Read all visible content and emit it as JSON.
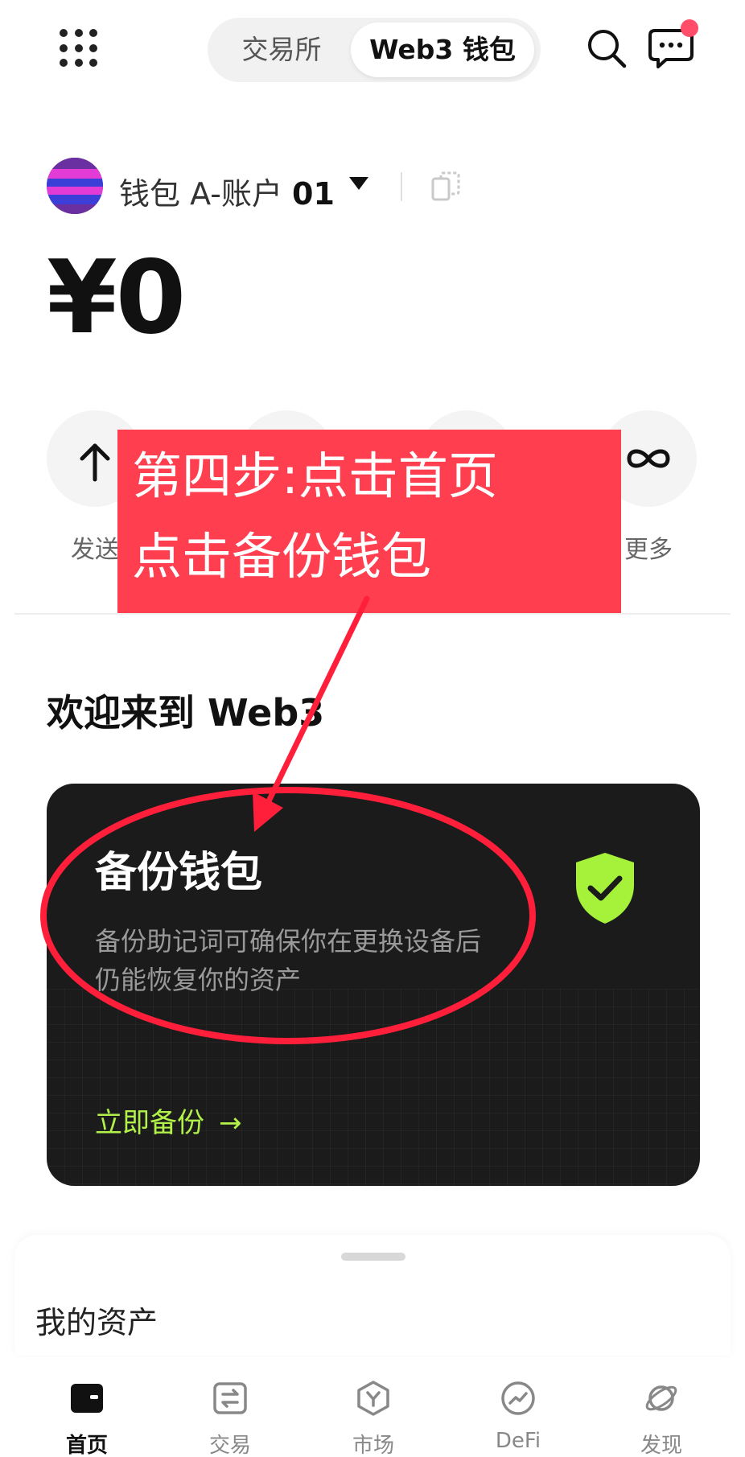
{
  "header": {
    "tabs": [
      {
        "label": "交易所",
        "active": false
      },
      {
        "label": "Web3 钱包",
        "active": true
      }
    ],
    "notification_color": "#ff4d6a"
  },
  "account": {
    "name_prefix": "钱包 A-账户 ",
    "name_number": "01"
  },
  "balance": "¥0",
  "actions": [
    {
      "label": "发送",
      "icon": "arrow-up-icon"
    },
    {
      "label": "",
      "icon": "plus-icon"
    },
    {
      "label": "",
      "icon": "card-icon"
    },
    {
      "label": "更多",
      "icon": "infinity-icon"
    }
  ],
  "welcome": {
    "title": "欢迎来到 Web3"
  },
  "backup_card": {
    "title": "备份钱包",
    "description": "备份助记词可确保你在更换设备后仍能恢复你的资产",
    "link_label": "立即备份",
    "link_arrow": "→",
    "accent_color": "#b2f04a"
  },
  "assets": {
    "title": "我的资产"
  },
  "tabbar": [
    {
      "label": "首页",
      "icon": "home-wallet-icon",
      "active": true
    },
    {
      "label": "交易",
      "icon": "swap-icon",
      "active": false
    },
    {
      "label": "市场",
      "icon": "market-hex-icon",
      "active": false
    },
    {
      "label": "DeFi",
      "icon": "defi-chart-icon",
      "active": false
    },
    {
      "label": "发现",
      "icon": "planet-icon",
      "active": false
    }
  ],
  "annotation": {
    "line1": "第四步:点击首页",
    "line2": "点击备份钱包",
    "color": "#ff3f50"
  }
}
